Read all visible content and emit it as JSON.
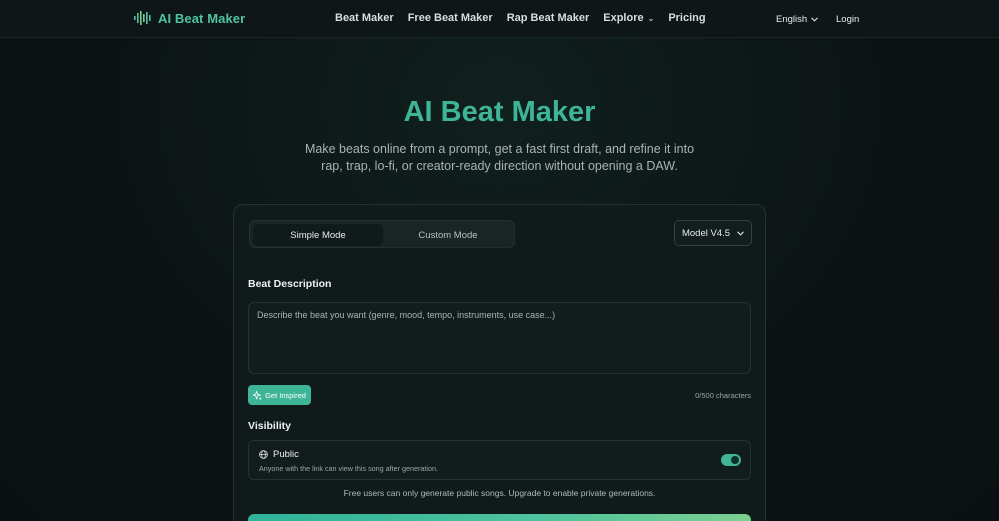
{
  "header": {
    "logo_text": "AI Beat Maker",
    "nav": [
      {
        "label": "Beat Maker"
      },
      {
        "label": "Free Beat Maker"
      },
      {
        "label": "Rap Beat Maker"
      },
      {
        "label": "Explore",
        "has_dropdown": true
      },
      {
        "label": "Pricing"
      }
    ],
    "language": "English",
    "login": "Login"
  },
  "hero": {
    "title": "AI Beat Maker",
    "subtitle": "Make beats online from a prompt, get a fast first draft, and refine it into rap, trap, lo-fi, or creator-ready direction without opening a DAW."
  },
  "form": {
    "modes": [
      "Simple Mode",
      "Custom Mode"
    ],
    "active_mode": "Simple Mode",
    "model": "Model V4.5",
    "description_label": "Beat Description",
    "description_placeholder": "Describe the beat you want (genre, mood, tempo, instruments, use case...)",
    "description_value": "",
    "inspire_label": "Get Inspired",
    "char_count": "0/500 characters",
    "visibility_label": "Visibility",
    "visibility_option": "Public",
    "visibility_desc": "Anyone with the link can view this song after generation.",
    "visibility_public_on": true,
    "free_note": "Free users can only generate public songs. Upgrade to enable private generations."
  },
  "colors": {
    "accent": "#3fb598",
    "background": "#0c1413",
    "card": "#111a1b"
  },
  "icons": {
    "logo": "waveform-icon",
    "inspire": "sparkle-icon",
    "public": "globe-icon",
    "dropdown": "chevron-down-icon"
  }
}
